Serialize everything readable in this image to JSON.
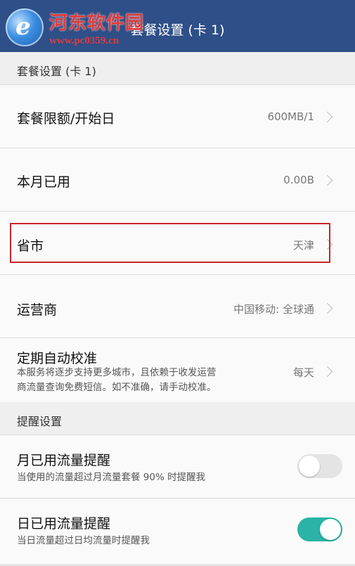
{
  "app_bar": {
    "title": "套餐设置 (卡 1)"
  },
  "watermark": {
    "name": "河东软件园",
    "url": "www.pc0359.cn"
  },
  "sections": {
    "plan_settings_header": "套餐设置 (卡 1)",
    "reminder_settings_header": "提醒设置"
  },
  "rows": {
    "plan_limit": {
      "label": "套餐限额/开始日",
      "value": "600MB/1"
    },
    "month_used": {
      "label": "本月已用",
      "value": "0.00B"
    },
    "province_city": {
      "label": "省市",
      "value": "天津"
    },
    "carrier": {
      "label": "运营商",
      "value": "中国移动: 全球通"
    },
    "auto_calibrate": {
      "label": "定期自动校准",
      "description_line1": "本服务将逐步支持更多城市，且依赖于收发运营",
      "description_line2": "商流量查询免费短信。如不准确，请手动校准。",
      "value": "每天"
    },
    "monthly_alert": {
      "label": "月已用流量提醒",
      "description": "当使用的流量超过月流量套餐 90% 时提醒我",
      "enabled": false
    },
    "daily_alert": {
      "label": "日已用流量提醒",
      "description": "当日流量超过日均流量时提醒我",
      "enabled": true
    }
  },
  "colors": {
    "app_bar": "#2f4f88",
    "highlight_border": "#c8252b",
    "toggle_on": "#2ab3a6",
    "toggle_off": "#e4e4e4"
  }
}
